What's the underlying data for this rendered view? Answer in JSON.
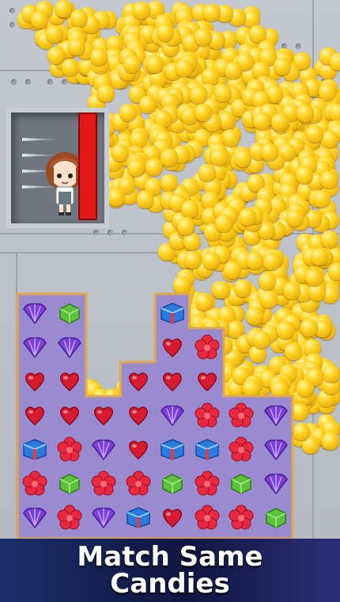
{
  "banner": {
    "line1": "Match Same",
    "line2": "Candies"
  },
  "colors": {
    "pin": "#e01818",
    "board_fill": "#9a8ad0",
    "board_border": "#e0a94a",
    "gold": "#ffd21e",
    "banner_bg": "#0f1640"
  },
  "board": {
    "columns": [
      {
        "col": 1,
        "rows": 7
      },
      {
        "col": 2,
        "rows": 7
      },
      {
        "col": 3,
        "rows": 4
      },
      {
        "col": 4,
        "rows": 5
      },
      {
        "col": 5,
        "rows": 7
      },
      {
        "col": 6,
        "rows": 6
      },
      {
        "col": 7,
        "rows": 4
      },
      {
        "col": 8,
        "rows": 4
      }
    ],
    "pieces": [
      [
        "shell-purple",
        "flower-red",
        "blue-box",
        "heart-red",
        "heart-red",
        "shell-purple",
        "shell-purple"
      ],
      [
        "flower-red",
        "green-cube",
        "flower-red",
        "heart-red",
        "heart-red",
        "shell-purple",
        "green-cube"
      ],
      [
        "shell-purple",
        "flower-red",
        "shell-purple",
        "heart-red"
      ],
      [
        "blue-box",
        "flower-red",
        "heart-red",
        "heart-red",
        "heart-red"
      ],
      [
        "heart-red",
        "green-cube",
        "blue-box",
        "shell-purple",
        "heart-red",
        "heart-red",
        "blue-box"
      ],
      [
        "flower-red",
        "flower-red",
        "blue-box",
        "flower-red",
        "heart-red",
        "flower-red"
      ],
      [
        "flower-red",
        "green-cube",
        "flower-red",
        "flower-red"
      ],
      [
        "green-cube",
        "shell-purple",
        "shell-purple",
        "shell-purple"
      ]
    ]
  },
  "character": {
    "icon": "girl-character-icon"
  },
  "obstacles": {
    "icon": "spike-icon",
    "count": 4
  }
}
